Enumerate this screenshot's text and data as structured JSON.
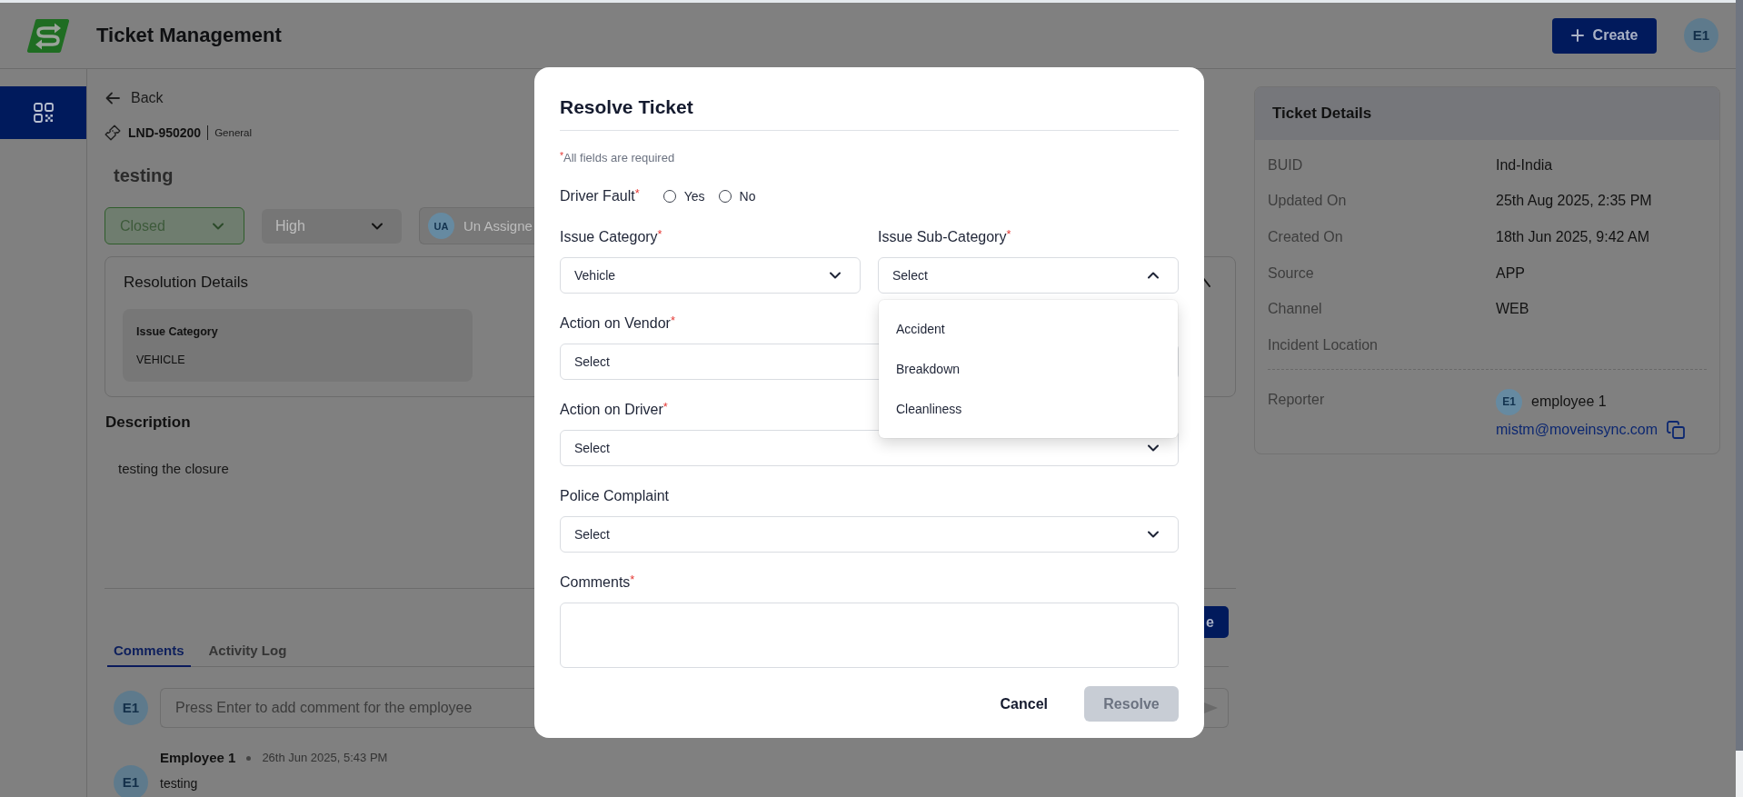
{
  "header": {
    "title": "Ticket Management",
    "create_button": "Create",
    "avatar": "E1"
  },
  "sidebar": {
    "items": [
      {
        "selected": true
      }
    ]
  },
  "ticket": {
    "back_link": "Back",
    "id": "LND-950200",
    "type": "General",
    "title": "testing",
    "dropdowns": [
      {
        "kind": "status",
        "value": "Closed",
        "disabled": false
      },
      {
        "kind": "priority",
        "value": "High",
        "disabled": true
      },
      {
        "kind": "assignee",
        "avatar": "UA",
        "value": "Un Assigne",
        "disabled": true
      }
    ]
  },
  "resolution_details": {
    "title": "Resolution Details",
    "fields": [
      {
        "label": "Issue Category",
        "value": "VEHICLE"
      }
    ]
  },
  "description": {
    "title": "Description",
    "text": "testing the closure"
  },
  "action_button": {
    "label": "e"
  },
  "tabs": [
    {
      "label": "Comments",
      "selected": true
    },
    {
      "label": "Activity Log",
      "selected": false
    }
  ],
  "comment_box": {
    "avatar": "E1",
    "placeholder": "Press Enter to add comment for the employee"
  },
  "comments": [
    {
      "avatar": "E1",
      "author": "Employee 1",
      "time": "26th Jun 2025, 5:43 PM",
      "text": "testing"
    }
  ],
  "ticket_details": {
    "title": "Ticket Details",
    "rows": [
      {
        "label": "BUID",
        "value": "Ind-India"
      },
      {
        "label": "Updated On",
        "value": "25th Aug 2025, 2:35 PM"
      },
      {
        "label": "Created On",
        "value": "18th Jun 2025, 9:42 AM"
      },
      {
        "label": "Source",
        "value": "APP"
      },
      {
        "label": "Channel",
        "value": "WEB"
      },
      {
        "label": "Incident Location"
      }
    ],
    "reporter": {
      "label": "Reporter",
      "avatar": "E1",
      "name": "employee 1",
      "email": "mistm@moveinsync.com"
    }
  },
  "modal": {
    "title": "Resolve Ticket",
    "note": "$^{*}$All fields are required",
    "rows": [
      [
        {
          "kind": "radio",
          "label": "Driver Fault$^{*}$",
          "options": [
            {
              "label": "Yes",
              "selected": false
            },
            {
              "label": "No",
              "selected": false
            }
          ]
        }
      ],
      [
        {
          "kind": "select",
          "label": "Issue Category$^{*}$",
          "value": "Vehicle",
          "expanded": false
        },
        {
          "kind": "select",
          "label": "Issue Sub-Category$^{*}$",
          "placeholder": "Select",
          "expanded": true,
          "options": [
            "Accident",
            "Breakdown",
            "Cleanliness"
          ]
        }
      ],
      [
        {
          "kind": "select",
          "label": "Action on Vendor$^{*}$",
          "placeholder": "Select",
          "expanded": false
        }
      ],
      [
        {
          "kind": "select",
          "label": "Action on Driver$^{*}$",
          "placeholder": "Select",
          "expanded": false
        }
      ],
      [
        {
          "kind": "select",
          "label": "Police Complaint",
          "placeholder": "Select",
          "expanded": false
        }
      ],
      [
        {
          "kind": "textarea",
          "label": "Comments$^{*}$"
        }
      ]
    ],
    "buttons": [
      {
        "label": "Cancel",
        "kind": "text",
        "disabled": false
      },
      {
        "label": "Resolve",
        "kind": "primary",
        "disabled": true
      }
    ]
  }
}
